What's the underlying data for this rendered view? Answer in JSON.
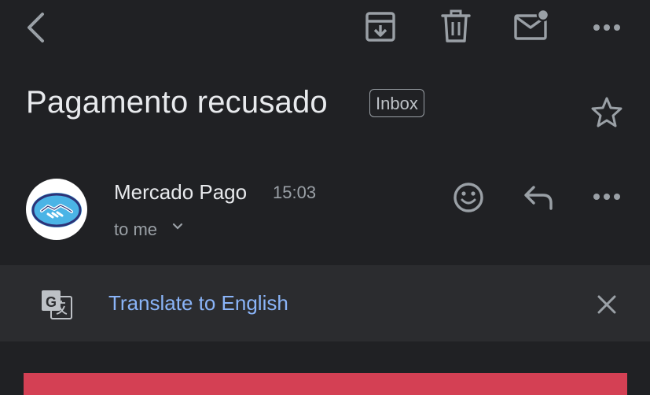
{
  "toolbar": {
    "back_icon": "arrow-back-icon",
    "archive_icon": "archive-icon",
    "delete_icon": "trash-icon",
    "mark_unread_icon": "mail-unread-icon",
    "more_icon": "more-horizontal-icon"
  },
  "message": {
    "subject": "Pagamento recusado",
    "label": "Inbox",
    "star_icon": "star-outline-icon"
  },
  "sender": {
    "name": "Mercado Pago",
    "time": "15:03",
    "recipient": "to me",
    "avatar_icon": "mercado-pago-handshake-logo",
    "react_icon": "emoji-smile-icon",
    "reply_icon": "reply-icon",
    "more_icon": "more-horizontal-icon"
  },
  "translate": {
    "icon": "google-translate-icon",
    "link": "Translate to English",
    "close_icon": "close-icon"
  },
  "colors": {
    "background": "#202124",
    "translate_bar": "#2b2c2f",
    "link": "#8ab4f8",
    "banner": "#d44054",
    "brand_blue": "#2d3277",
    "brand_light_blue": "#4bb4e6"
  }
}
